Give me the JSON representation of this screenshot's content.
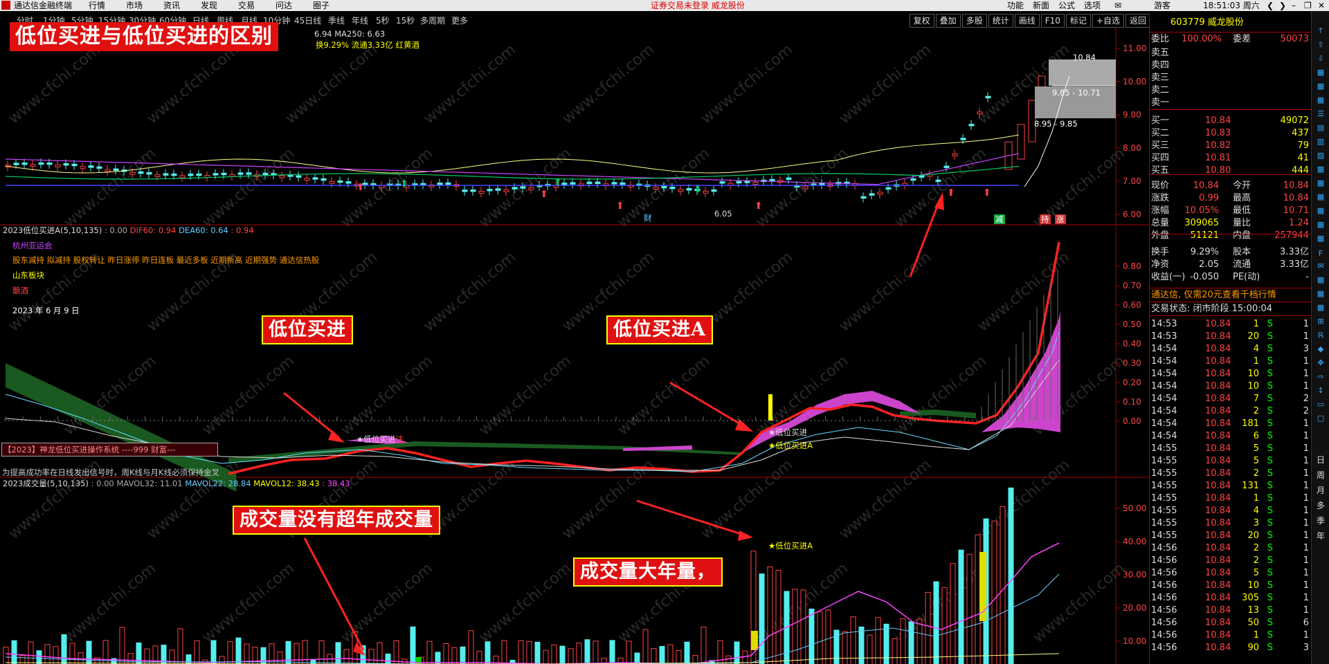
{
  "menubar": {
    "app_title": "通达信金融终端",
    "menus": [
      "行情",
      "市场",
      "资讯",
      "发现",
      "交易",
      "问达",
      "圈子"
    ],
    "notice": "证券交易未登录  威龙股份",
    "right_items": [
      "功能",
      "新面",
      "公式",
      "选项"
    ],
    "user": "游客",
    "clock": "18:51:03 周六"
  },
  "toolbar": {
    "periods": [
      "分时",
      "1分钟",
      "5分钟",
      "15分钟",
      "30分钟",
      "60分钟",
      "日线",
      "周线",
      "月线",
      "10分钟",
      "45日线",
      "季线",
      "年线",
      "5秒",
      "15秒",
      "多周期",
      "更多"
    ],
    "tools": [
      "复权",
      "叠加",
      "多股",
      "统计",
      "画线",
      "F10",
      "标记",
      "+自选",
      "返回"
    ]
  },
  "titles": {
    "main": "低位买进与低位买进的区别",
    "buy_a": "低位买进",
    "buy_b": "低位买进A",
    "vol_a": "成交量没有超年成交量",
    "vol_b": "成交量大年量，"
  },
  "chart1": {
    "info_ma": "6.94  MA250: 6.63",
    "info2": "换9.29% 流通3.33亿 红黄酒",
    "popup_high": "10.84",
    "popup_mid": "9.85 - 10.71",
    "popup_low": "8.95 - 9.85",
    "low_label": "6.05",
    "cai": "财",
    "tags": [
      "减",
      "持",
      "涨"
    ]
  },
  "chart2": {
    "header_name": "2023低位买进A(5,10,135)",
    "header_v0": ": 0.00",
    "header_dif": "DIF60: 0.94",
    "header_dea": "DEA60: 0.64",
    "header_v3": ": 0.94",
    "concept1": "杭州亚运会",
    "concept2": "股东减持 拟减持 股权转让 昨日涨停 昨日连板 最近多板 近期新高 近期强势 通达信热股",
    "concept3": "山东板块",
    "concept4": "酿酒",
    "date": "2023 年 6 月 9 日",
    "signal1": "★低位买进",
    "signal1b": "注",
    "signal2": "★低位买进",
    "signal3": "★低位买进A",
    "system_box": "【2023】神龙低位买进操作系统 ----999 财富---",
    "tip": "为提高成功率在日线发出信号时，周K线与月K线必须保持金叉"
  },
  "chart3": {
    "header_name": "2023成交量(5,10,135)",
    "header_v0": ": 0.00",
    "header_mavol32": "MAVOL32: 11.01",
    "header_mavol22": "MAVOL22: 28.84",
    "header_mavol12": "MAVOL12: 38.43",
    "header_v4": ": 38.43",
    "signal": "★低位买进A"
  },
  "axes": {
    "price": [
      "11.00",
      "10.00",
      "9.00",
      "8.00",
      "7.00",
      "6.00"
    ],
    "indicator": [
      "0.80",
      "0.70",
      "0.60",
      "0.50",
      "0.40",
      "0.30",
      "0.20",
      "0.10",
      "0.00"
    ],
    "volume": [
      "50.00",
      "40.00",
      "30.00",
      "20.00",
      "10.00"
    ]
  },
  "watermark": "www.cfchi.com",
  "right_panel": {
    "code": "603779",
    "name": "威龙股份",
    "weibi_label": "委比",
    "weibi": "100.00%",
    "weicha_label": "委差",
    "weicha": "50073",
    "sells": [
      {
        "label": "卖五",
        "price": "",
        "vol": ""
      },
      {
        "label": "卖四",
        "price": "",
        "vol": ""
      },
      {
        "label": "卖三",
        "price": "",
        "vol": ""
      },
      {
        "label": "卖二",
        "price": "",
        "vol": ""
      },
      {
        "label": "卖一",
        "price": "",
        "vol": ""
      }
    ],
    "buys": [
      {
        "label": "买一",
        "price": "10.84",
        "vol": "49072"
      },
      {
        "label": "买二",
        "price": "10.83",
        "vol": "437"
      },
      {
        "label": "买三",
        "price": "10.82",
        "vol": "79"
      },
      {
        "label": "买四",
        "price": "10.81",
        "vol": "41"
      },
      {
        "label": "买五",
        "price": "10.80",
        "vol": "444"
      }
    ],
    "stats": [
      {
        "l1": "现价",
        "v1": "10.84",
        "l2": "今开",
        "v2": "10.84"
      },
      {
        "l1": "涨跌",
        "v1": "0.99",
        "l2": "最高",
        "v2": "10.84"
      },
      {
        "l1": "涨幅",
        "v1": "10.05%",
        "l2": "最低",
        "v2": "10.71"
      },
      {
        "l1": "总量",
        "v1": "309065",
        "l2": "量比",
        "v2": "1.24"
      },
      {
        "l1": "外盘",
        "v1": "51121",
        "l2": "内盘",
        "v2": "257944"
      },
      {
        "l1": "换手",
        "v1": "9.29%",
        "l2": "股本",
        "v2": "3.33亿"
      },
      {
        "l1": "净资",
        "v1": "2.05",
        "l2": "流通",
        "v2": "3.33亿"
      },
      {
        "l1": "收益(一)",
        "v1": "-0.050",
        "l2": "PE(动)",
        "v2": "-"
      }
    ],
    "ad": "通达信, 仅需20元查看千档行情",
    "state": "交易状态: 闭市阶段 15:00:04",
    "ticks": [
      [
        "14:53",
        "10.84",
        "1",
        "S",
        "1"
      ],
      [
        "14:53",
        "10.84",
        "20",
        "S",
        "1"
      ],
      [
        "14:54",
        "10.84",
        "4",
        "S",
        "3"
      ],
      [
        "14:54",
        "10.84",
        "1",
        "S",
        "1"
      ],
      [
        "14:54",
        "10.84",
        "10",
        "S",
        "1"
      ],
      [
        "14:54",
        "10.84",
        "10",
        "S",
        "1"
      ],
      [
        "14:54",
        "10.84",
        "7",
        "S",
        "2"
      ],
      [
        "14:54",
        "10.84",
        "2",
        "S",
        "2"
      ],
      [
        "14:54",
        "10.84",
        "181",
        "S",
        "1"
      ],
      [
        "14:54",
        "10.84",
        "6",
        "S",
        "1"
      ],
      [
        "14:55",
        "10.84",
        "5",
        "S",
        "1"
      ],
      [
        "14:55",
        "10.84",
        "5",
        "S",
        "1"
      ],
      [
        "14:55",
        "10.84",
        "2",
        "S",
        "1"
      ],
      [
        "14:55",
        "10.84",
        "131",
        "S",
        "1"
      ],
      [
        "14:55",
        "10.84",
        "1",
        "S",
        "1"
      ],
      [
        "14:55",
        "10.84",
        "4",
        "S",
        "1"
      ],
      [
        "14:55",
        "10.84",
        "3",
        "S",
        "1"
      ],
      [
        "14:55",
        "10.84",
        "20",
        "S",
        "1"
      ],
      [
        "14:56",
        "10.84",
        "2",
        "S",
        "1"
      ],
      [
        "14:56",
        "10.84",
        "2",
        "S",
        "1"
      ],
      [
        "14:56",
        "10.84",
        "5",
        "S",
        "1"
      ],
      [
        "14:56",
        "10.84",
        "10",
        "S",
        "1"
      ],
      [
        "14:56",
        "10.84",
        "305",
        "S",
        "1"
      ],
      [
        "14:56",
        "10.84",
        "13",
        "S",
        "1"
      ],
      [
        "14:56",
        "10.84",
        "50",
        "S",
        "6"
      ],
      [
        "14:56",
        "10.84",
        "1",
        "S",
        "1"
      ],
      [
        "14:56",
        "10.84",
        "90",
        "S",
        "3"
      ]
    ]
  },
  "side_tabs": [
    "日",
    "周",
    "月",
    "多",
    "季",
    "年"
  ]
}
